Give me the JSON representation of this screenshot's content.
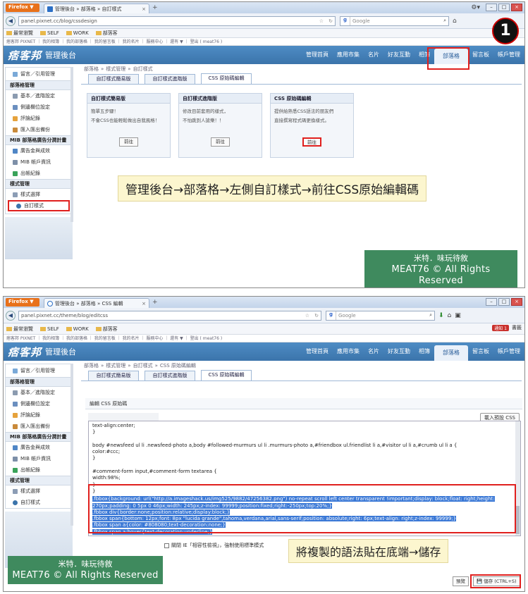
{
  "browser": {
    "firefox_label": "Firefox ▼",
    "back_icon": "back-arrow-icon",
    "search_placeholder": "Google",
    "bookmarks": [
      "最常瀏覽",
      "SELF",
      "WORK",
      "部落客"
    ]
  },
  "screenshot1": {
    "tab_title": "管理後台 » 部落格 » 自訂樣式",
    "url": "panel.pixnet.cc/blog/cssdesign",
    "pixnet_bar": "痞客邦 PIXNET ｜ 我的相簿 ｜ 我的部落格 ｜ 我的留言板 ｜ 我的名片 ｜ 服務中心 ｜ 還有 ▼ ｜ 登出 ( meat76 )",
    "logo": "痞客邦",
    "logo_sub": "管理後台",
    "menu": [
      "管理首頁",
      "應用市集",
      "名片",
      "好友互動",
      "相簿",
      "部落格",
      "留言板",
      "帳戶管理"
    ],
    "sidebar": {
      "top": "留言／引用管理",
      "groups": [
        {
          "title": "部落格管理",
          "items": [
            "基本／進階設定",
            "側邊欄位設定",
            "評論紀錄",
            "匯入匯出備份"
          ]
        },
        {
          "title": "MIB 部落格廣告分潤計畫",
          "items": [
            "廣告金與成效",
            "MIB 帳戶資訊",
            "出帳紀錄"
          ]
        },
        {
          "title": "樣式管理",
          "items": [
            "樣式選擇",
            "自訂樣式"
          ]
        }
      ]
    },
    "crumbs": [
      "部落格",
      "»",
      "樣式管理",
      "»",
      "自訂樣式"
    ],
    "tabs": [
      "自訂樣式簡易版",
      "自訂樣式進階版",
      "CSS 原始碼編輯"
    ],
    "cards": [
      {
        "title": "自訂樣式簡易版",
        "lines": [
          "簡單五步驟！",
          "不會CSS也能輕鬆做出自我風格！"
        ],
        "button": "前往"
      },
      {
        "title": "自訂樣式進階版",
        "lines": [
          "修改目前套用的樣式，",
          "不怕跳到人搶樂！！"
        ],
        "button": "前往"
      },
      {
        "title": "CSS 原始碼編輯",
        "lines": [
          "提供給熟悉CSS語法的朋友們",
          "直接撰寫程式碼更換樣式。"
        ],
        "button": "前往"
      }
    ],
    "caption": "管理後台→部落格→左側自訂樣式→前往CSS原始編輯碼",
    "step_number": "1"
  },
  "screenshot2": {
    "tab_title": "管理後台 » 部落格 » CSS 編輯",
    "url": "panel.pixnet.cc/theme/blog/editcss",
    "notify": "通知 1",
    "bookmark_right": "書籤",
    "crumbs": [
      "部落格",
      "»",
      "樣式管理",
      "»",
      "自訂樣式",
      "»",
      "CSS 原始碼編輯"
    ],
    "editor_title": "編輯 CSS 原始碼",
    "load_default": "載入預設 CSS",
    "code_lines": [
      "text-align:center;",
      "}",
      "",
      "body #newsfeed ul li .newsfeed-photo a,body #followed-murmurs ul li .murmurs-photo a,#friendbox ul.friendlist li a,#visitor ul li a,#crumb ul li a {",
      "color:#ccc;",
      "}",
      "",
      "#comment-form input,#comment-form textarea {",
      "width:98%;",
      "}"
    ],
    "highlighted_lines": [
      ".fbbox{background: url(\"http://a.imageshack.us/img525/9882/47256382.png\") no-repeat scroll left center transparent !important;display: block;float: right;height: 270px;padding: 0 5px 0 46px;width: 245px;z-index: 99999;position:fixed;right:-250px;top:20%;}",
      ".fbbox div{border:none;position:relative;display:block;}",
      ".fbbox span{bottom: 12px;font: 8px \"lucida grande\",tahoma,verdana,arial,sans-serif;position: absolute;right: 6px;text-align: right;z-index: 99999;}",
      ".fbbox span a{color: #808080;text-decoration:none;}",
      ".fbbox span a:hover{text-decoration:underline;}"
    ],
    "ie_check": "關閉 IE「相容性檢視」，強制使用標準模式",
    "preview": "預覽",
    "save": "儲存 (CTRL+S)",
    "caption": "將複製的語法貼在底端→儲存"
  },
  "watermark": {
    "line1": "米特．味玩待敘",
    "line2": "MEAT76 © All Rights Reserved"
  },
  "colors": {
    "header": "#3f7db5",
    "highlight": "#e0201e",
    "watermark": "#3f8a5e",
    "caption_bg": "#fcf6cf"
  }
}
